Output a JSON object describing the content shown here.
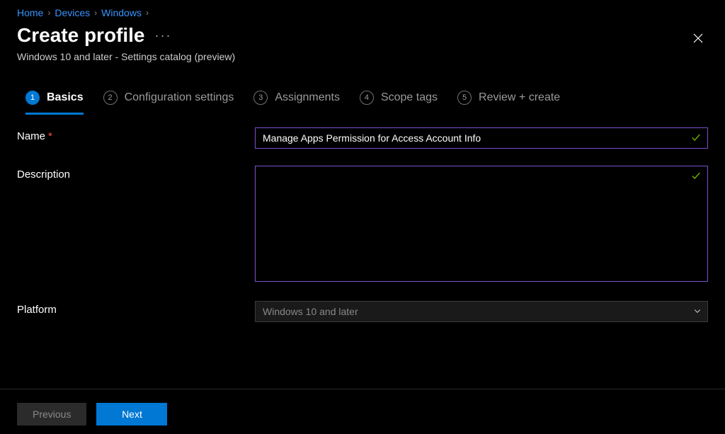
{
  "breadcrumbs": [
    "Home",
    "Devices",
    "Windows"
  ],
  "header": {
    "title": "Create profile",
    "subtitle": "Windows 10 and later - Settings catalog (preview)"
  },
  "steps": [
    {
      "num": "1",
      "label": "Basics",
      "active": true
    },
    {
      "num": "2",
      "label": "Configuration settings",
      "active": false
    },
    {
      "num": "3",
      "label": "Assignments",
      "active": false
    },
    {
      "num": "4",
      "label": "Scope tags",
      "active": false
    },
    {
      "num": "5",
      "label": "Review + create",
      "active": false
    }
  ],
  "form": {
    "name_label": "Name",
    "name_value": "Manage Apps Permission for Access Account Info",
    "description_label": "Description",
    "description_value": "",
    "platform_label": "Platform",
    "platform_value": "Windows 10 and later"
  },
  "footer": {
    "previous": "Previous",
    "next": "Next"
  }
}
